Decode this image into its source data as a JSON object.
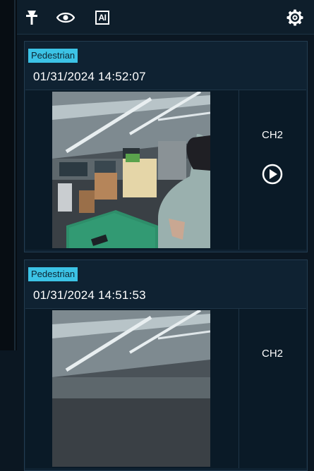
{
  "toolbar": {
    "icons": [
      "pin-icon",
      "eye-icon",
      "ai-icon",
      "gear-icon"
    ],
    "ai_label": "AI"
  },
  "events": [
    {
      "tag": "Pedestrian",
      "timestamp": "01/31/2024 14:52:07",
      "channel": "CH2"
    },
    {
      "tag": "Pedestrian",
      "timestamp": "01/31/2024 14:51:53",
      "channel": "CH2"
    }
  ],
  "colors": {
    "background": "#0b1722",
    "card": "#0f2232",
    "tag": "#3cc3e6",
    "text": "#ffffff"
  }
}
